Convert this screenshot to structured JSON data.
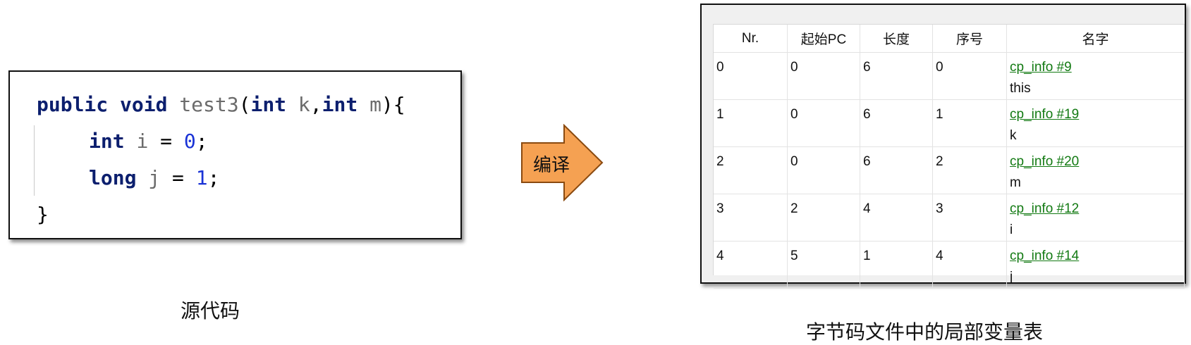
{
  "code": {
    "line1": {
      "kw1": "public",
      "kw2": "void",
      "method": "test3",
      "open": "(",
      "type1": "int",
      "p1": "k",
      "comma": ",",
      "type2": "int",
      "p2": "m",
      "close": "){"
    },
    "line2": {
      "type": "int",
      "name": "i",
      "eq": " = ",
      "value": "0",
      "semi": ";"
    },
    "line3": {
      "type": "long",
      "name": "j",
      "eq": " = ",
      "value": "1",
      "semi": ";"
    },
    "line4": {
      "brace": "}"
    }
  },
  "captions": {
    "source": "源代码",
    "bytecode": "字节码文件中的局部变量表"
  },
  "arrow": {
    "label": "编译",
    "fill": "#f5a152",
    "stroke": "#8a4a10"
  },
  "table": {
    "headers": [
      "Nr.",
      "起始PC",
      "长度",
      "序号",
      "名字"
    ],
    "rows": [
      {
        "nr": "0",
        "start_pc": "0",
        "length": "6",
        "index": "0",
        "name_ref": "cp_info #9",
        "name": "this"
      },
      {
        "nr": "1",
        "start_pc": "0",
        "length": "6",
        "index": "1",
        "name_ref": "cp_info #19",
        "name": "k"
      },
      {
        "nr": "2",
        "start_pc": "0",
        "length": "6",
        "index": "2",
        "name_ref": "cp_info #20",
        "name": "m"
      },
      {
        "nr": "3",
        "start_pc": "2",
        "length": "4",
        "index": "3",
        "name_ref": "cp_info #12",
        "name": "i"
      },
      {
        "nr": "4",
        "start_pc": "5",
        "length": "1",
        "index": "4",
        "name_ref": "cp_info #14",
        "name": "j"
      }
    ]
  }
}
